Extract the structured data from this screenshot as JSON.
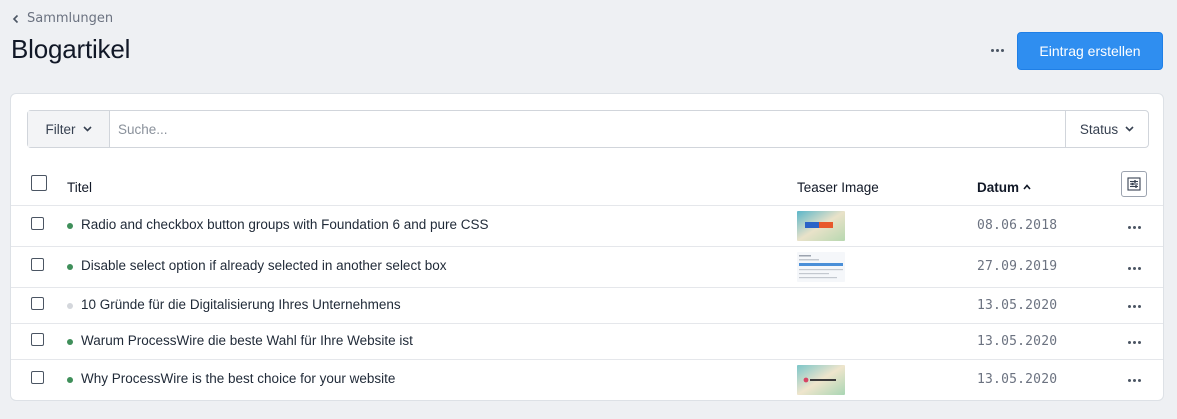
{
  "breadcrumb": {
    "label": "Sammlungen"
  },
  "page": {
    "title": "Blogartikel"
  },
  "header_actions": {
    "create_label": "Eintrag erstellen"
  },
  "toolbar": {
    "filter_label": "Filter",
    "search_placeholder": "Suche...",
    "search_value": "",
    "status_label": "Status"
  },
  "table": {
    "columns": {
      "title": "Titel",
      "teaser": "Teaser Image",
      "date": "Datum"
    },
    "sort": {
      "column": "Datum",
      "direction": "ascending"
    },
    "rows": [
      {
        "title": "Radio and checkbox button groups with Foundation 6 and pure CSS",
        "status_color": "#3f8f5a",
        "teaser": "colorful-banner-thumbnail",
        "date": "08.06.2018"
      },
      {
        "title": "Disable select option if already selected in another select box",
        "status_color": "#3f8f5a",
        "teaser": "form-screenshot-thumbnail",
        "date": "27.09.2019"
      },
      {
        "title": "10 Gründe für die Digitalisierung Ihres Unternehmens",
        "status_color": "#d4d7dc",
        "teaser": "",
        "date": "13.05.2020"
      },
      {
        "title": "Warum ProcessWire die beste Wahl für Ihre Website ist",
        "status_color": "#3f8f5a",
        "teaser": "",
        "date": "13.05.2020"
      },
      {
        "title": "Why ProcessWire is the best choice for your website",
        "status_color": "#3f8f5a",
        "teaser": "processwire-logo-thumbnail",
        "date": "13.05.2020"
      }
    ]
  },
  "colors": {
    "primary": "#2f8ef0",
    "published": "#3f8f5a",
    "unpublished": "#d4d7dc"
  }
}
